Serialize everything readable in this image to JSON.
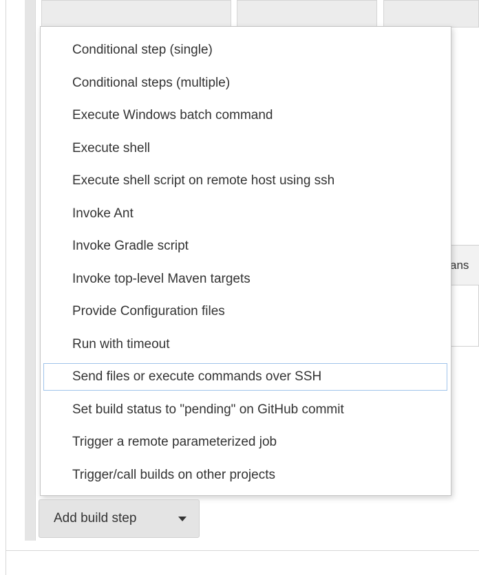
{
  "background": {
    "partial_tab_text": "ans"
  },
  "menu": {
    "items": [
      {
        "label": "Conditional step (single)"
      },
      {
        "label": "Conditional steps (multiple)"
      },
      {
        "label": "Execute Windows batch command"
      },
      {
        "label": "Execute shell"
      },
      {
        "label": "Execute shell script on remote host using ssh"
      },
      {
        "label": "Invoke Ant"
      },
      {
        "label": "Invoke Gradle script"
      },
      {
        "label": "Invoke top-level Maven targets"
      },
      {
        "label": "Provide Configuration files"
      },
      {
        "label": "Run with timeout"
      },
      {
        "label": "Send files or execute commands over SSH",
        "highlighted": true
      },
      {
        "label": "Set build status to \"pending\" on GitHub commit"
      },
      {
        "label": "Trigger a remote parameterized job"
      },
      {
        "label": "Trigger/call builds on other projects"
      }
    ]
  },
  "button": {
    "label": "Add build step",
    "icon": "caret-down-icon"
  },
  "colors": {
    "highlight_border": "#9fc3ea",
    "menu_text": "#333333",
    "button_bg": "#e4e4e4"
  }
}
